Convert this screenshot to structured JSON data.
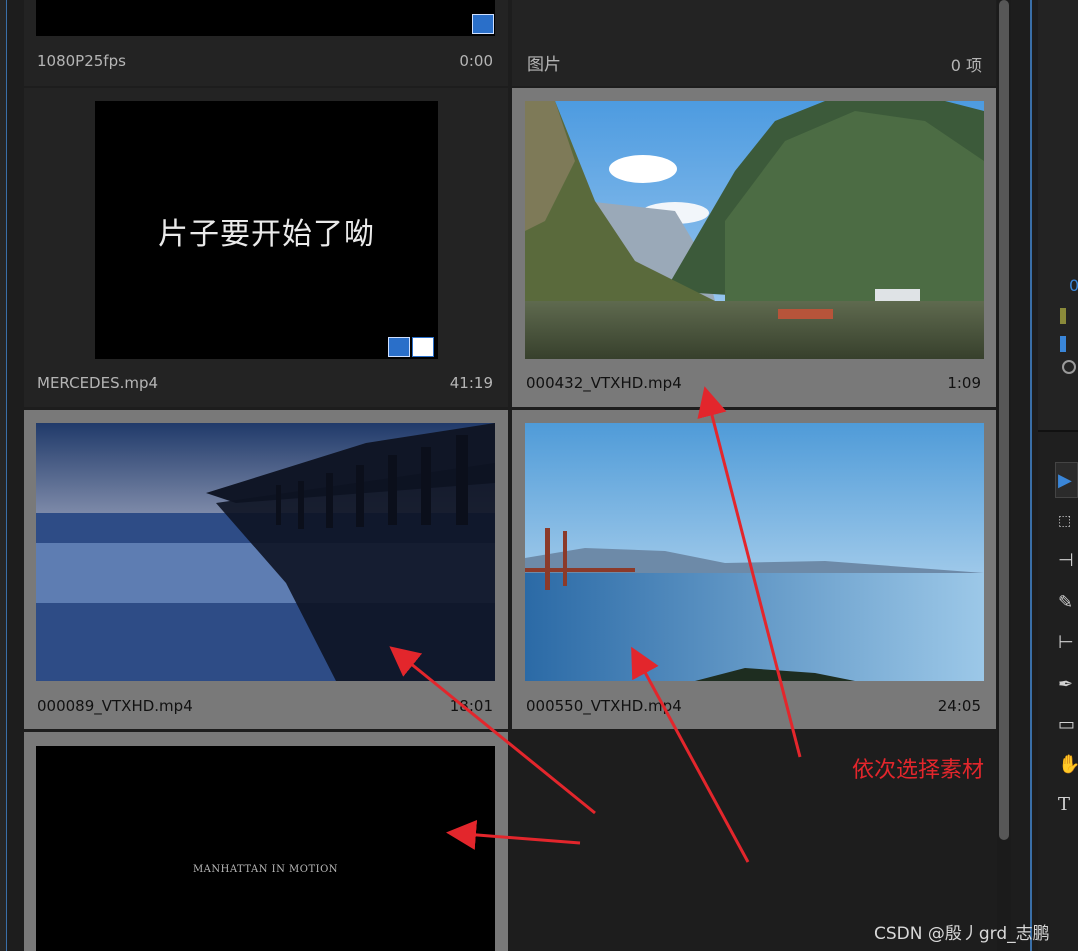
{
  "top_row": {
    "left_name": "1080P25fps",
    "left_duration": "0:00",
    "bin_name": "图片",
    "bin_count": "0 项"
  },
  "tiles": [
    {
      "name": "MERCEDES.mp4",
      "duration": "41:19",
      "title_text": "片子要开始了呦"
    },
    {
      "name": "000432_VTXHD.mp4",
      "duration": "1:09"
    },
    {
      "name": "000089_VTXHD.mp4",
      "duration": "18:01"
    },
    {
      "name": "000550_VTXHD.mp4",
      "duration": "24:05"
    },
    {
      "name": "",
      "duration": "",
      "title_text": "MANHATTAN IN MOTION"
    }
  ],
  "annotation": "依次选择素材",
  "right_panel": {
    "value": "0"
  },
  "tools": [
    "selection-tool-icon",
    "track-select-icon",
    "ripple-edit-icon",
    "razor-icon",
    "slip-icon",
    "pen-icon",
    "rectangle-icon",
    "hand-icon",
    "type-icon"
  ],
  "watermark": "CSDN @殷丿grd_志鹏",
  "colors": {
    "selection": "#797979",
    "annotation": "#e3262c",
    "accent": "#3a6fa8"
  }
}
